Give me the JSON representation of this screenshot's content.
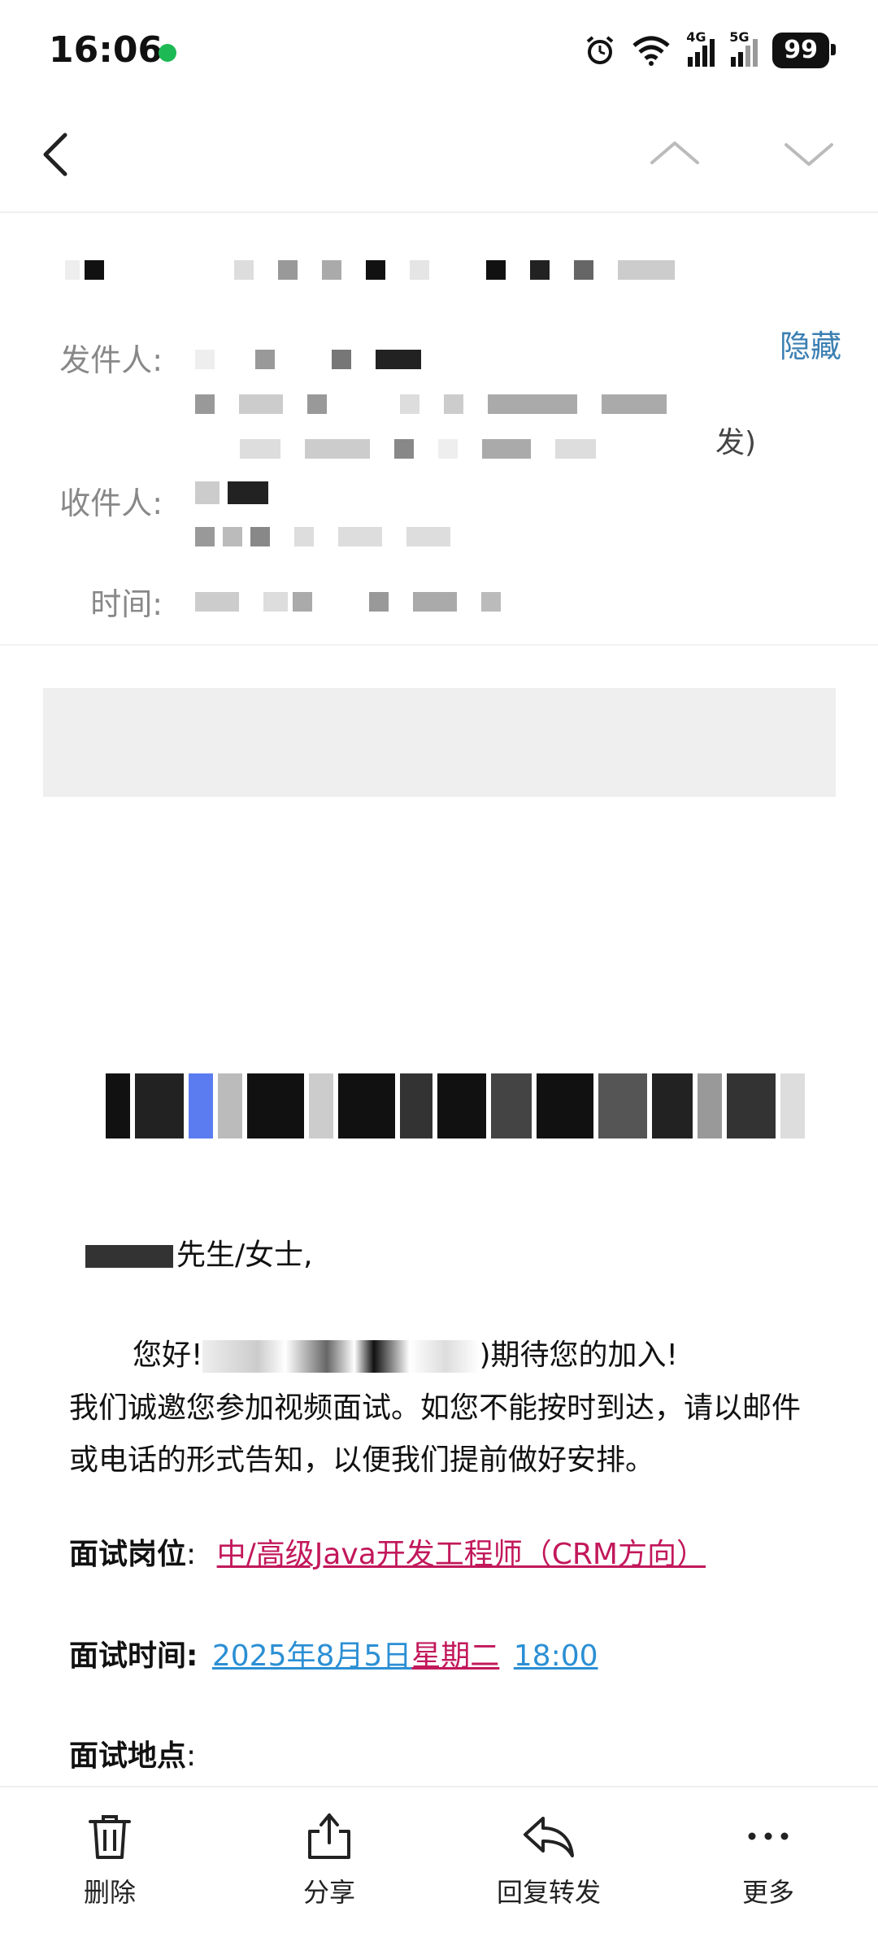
{
  "status_bar": {
    "time": "16:06",
    "signal_4g": "4G",
    "signal_5g": "5G",
    "battery": "99"
  },
  "header": {
    "sender_label": "发件人:",
    "recipient_label": "收件人:",
    "time_label": "时间:",
    "hide_link": "隐藏",
    "sender_tail": "发)"
  },
  "email": {
    "greeting": "先生/女士,",
    "para1_start": "您好!",
    "para1_end": ")期待您的加入!",
    "para2": "我们诚邀您参加视频面试。如您不能按时到达，请以邮件或电话的形式告知，以便我们提前做好安排。",
    "position_label": "面试岗位",
    "position_sep": ":",
    "position_value": "中/高级Java开发工程师（CRM方向）",
    "time_label": "面试时间:",
    "time_date": "2025年8月5日",
    "time_weekday": "星期二",
    "time_clock": "18:00",
    "location_label": "面试地点",
    "location_sep": ":"
  },
  "bottom_bar": {
    "delete": "删除",
    "share": "分享",
    "reply_forward": "回复转发",
    "more": "更多"
  },
  "colors": {
    "accent_link": "#3b7fb2",
    "link_red": "#c2185b",
    "link_blue": "#2b8fd4"
  }
}
